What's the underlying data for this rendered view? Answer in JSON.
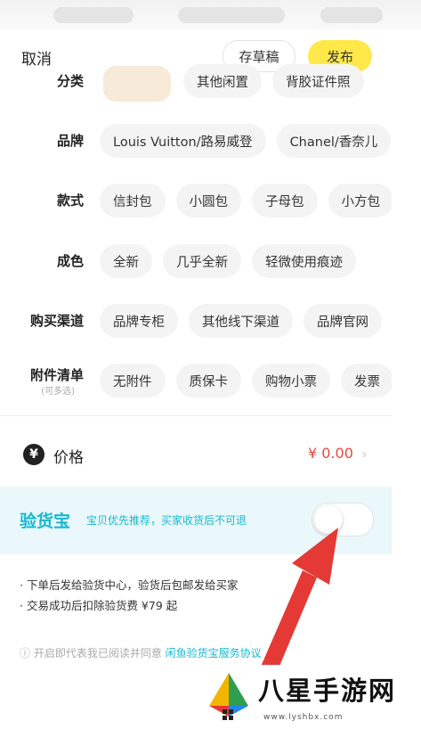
{
  "header": {
    "cancel": "取消",
    "draft": "存草稿",
    "publish": "发布"
  },
  "attributes": [
    {
      "label": "分类",
      "options": [
        "其他闲置",
        "背胶证件照"
      ]
    },
    {
      "label": "品牌",
      "options": [
        "Louis Vuitton/路易威登",
        "Chanel/香奈儿"
      ]
    },
    {
      "label": "款式",
      "options": [
        "信封包",
        "小圆包",
        "子母包",
        "小方包"
      ]
    },
    {
      "label": "成色",
      "options": [
        "全新",
        "几乎全新",
        "轻微使用痕迹"
      ]
    },
    {
      "label": "购买渠道",
      "options": [
        "品牌专柜",
        "其他线下渠道",
        "品牌官网"
      ]
    },
    {
      "label": "附件清单",
      "sublabel": "(可多选)",
      "options": [
        "无附件",
        "质保卡",
        "购物小票",
        "发票"
      ]
    }
  ],
  "price": {
    "icon": "yen-circle-icon",
    "label": "价格",
    "value": "¥ 0.00"
  },
  "verification": {
    "title": "验货宝",
    "description": "宝贝优先推荐，买家收货后不可退",
    "enabled": false
  },
  "notes": [
    "· 下单后发给验货中心，验货后包邮发给买家",
    "· 交易成功后扣除验货费 ¥79 起"
  ],
  "agreement": {
    "prefix": "开启即代表我已阅读并同意",
    "link": "闲鱼验货宝服务协议"
  },
  "watermark": {
    "name": "八星手游网",
    "url": "www.lyshbx.com"
  },
  "colors": {
    "publish": "#ffe94a",
    "price": "#e8483f",
    "accent": "#18b8d0",
    "arrow": "#e53935"
  }
}
